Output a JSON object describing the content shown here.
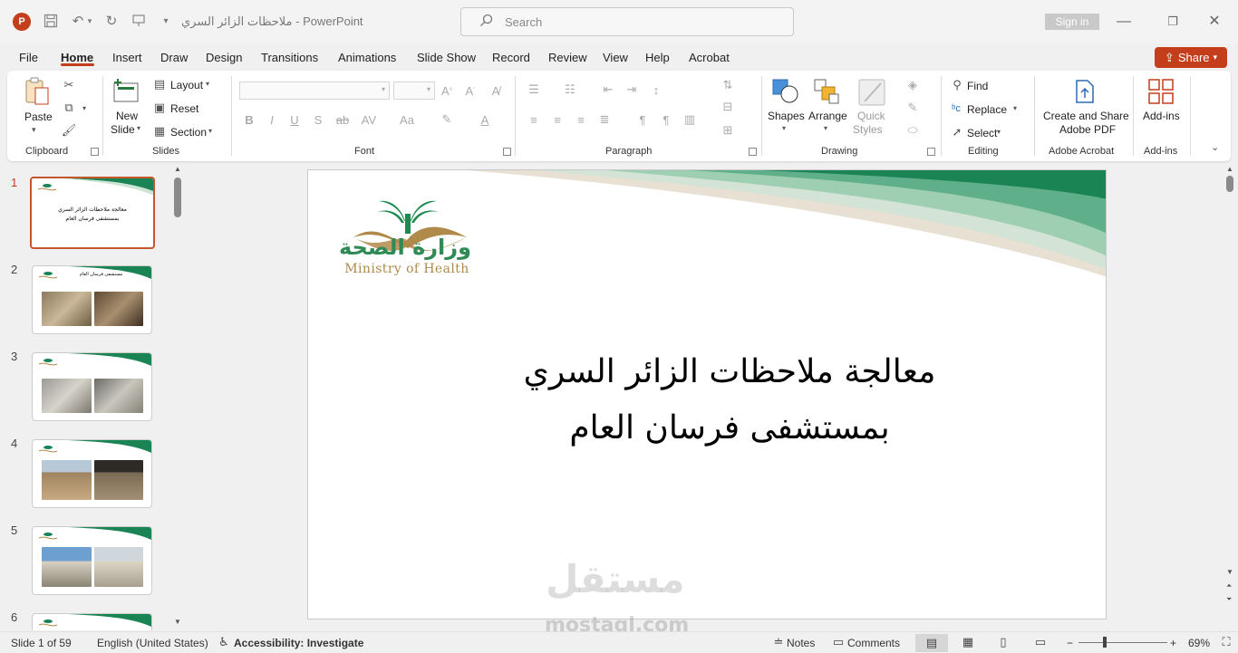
{
  "app": {
    "title": "ملاحظات الزائر السري  -  PowerPoint",
    "logo_letter": "P",
    "search_placeholder": "Search",
    "signin": "Sign in",
    "share": "Share"
  },
  "tabs": [
    "File",
    "Home",
    "Insert",
    "Draw",
    "Design",
    "Transitions",
    "Animations",
    "Slide Show",
    "Record",
    "Review",
    "View",
    "Help",
    "Acrobat"
  ],
  "active_tab": "Home",
  "ribbon": {
    "clipboard": {
      "label": "Clipboard",
      "paste": "Paste"
    },
    "slides": {
      "label": "Slides",
      "new_slide": "New",
      "new_slide_2": "Slide",
      "layout": "Layout",
      "reset": "Reset",
      "section": "Section"
    },
    "font": {
      "label": "Font"
    },
    "paragraph": {
      "label": "Paragraph"
    },
    "drawing": {
      "label": "Drawing",
      "shapes": "Shapes",
      "arrange": "Arrange",
      "quick": "Quick",
      "styles": "Styles"
    },
    "editing": {
      "label": "Editing",
      "find": "Find",
      "replace": "Replace",
      "select": "Select"
    },
    "adobe": {
      "label": "Adobe Acrobat",
      "line1": "Create and Share",
      "line2": "Adobe PDF"
    },
    "addins": {
      "label": "Add-ins",
      "button": "Add-ins"
    }
  },
  "slides_panel": {
    "numbers": [
      "1",
      "2",
      "3",
      "4",
      "5",
      "6"
    ],
    "thumb1_line1": "معالجة ملاحظات الزائر السري",
    "thumb1_line2": "بمستشفى فرسان العام",
    "thumb2_title": "مستشفى فرسان العام"
  },
  "slide": {
    "logo_arabic": "وزارة الصحة",
    "logo_english": "Ministry of Health",
    "title_line1": "معالجة ملاحظات الزائر السري",
    "title_line2": "بمستشفى فرسان العام",
    "watermark_ar": "مستقل",
    "watermark_en": "mostaql.com"
  },
  "status": {
    "slide_info": "Slide 1 of 59",
    "language": "English (United States)",
    "accessibility": "Accessibility: Investigate",
    "notes": "Notes",
    "comments": "Comments",
    "zoom": "69%"
  },
  "colors": {
    "accent": "#c43e1c",
    "green": "#1a8454",
    "gold": "#b08a4a"
  }
}
